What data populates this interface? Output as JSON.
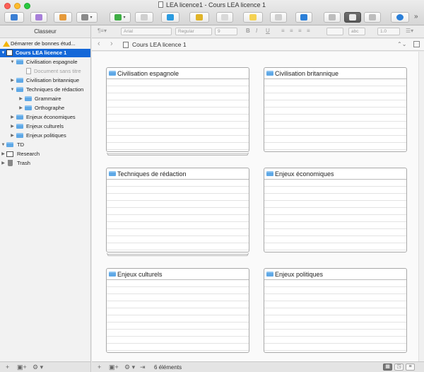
{
  "window": {
    "title": "LEA licence1 - Cours LEA licence 1"
  },
  "sidebar": {
    "header": "Classeur",
    "items": [
      {
        "label": "Démarrer de bonnes étud...",
        "icon": "warning-icon"
      },
      {
        "label": "Cours LEA licence 1",
        "icon": "book-icon",
        "selected": true
      },
      {
        "label": "Civilisation espagnole",
        "icon": "folder-icon"
      },
      {
        "label": "Document sans titre",
        "icon": "document-icon",
        "muted": true
      },
      {
        "label": "Civilisation britannique",
        "icon": "folder-icon"
      },
      {
        "label": "Techniques de rédaction",
        "icon": "folder-icon"
      },
      {
        "label": "Grammaire",
        "icon": "folder-icon"
      },
      {
        "label": "Orthographe",
        "icon": "folder-icon"
      },
      {
        "label": "Enjeux économiques",
        "icon": "folder-icon"
      },
      {
        "label": "Enjeux culturels",
        "icon": "folder-icon"
      },
      {
        "label": "Enjeux politiques",
        "icon": "folder-icon"
      },
      {
        "label": "TD",
        "icon": "folder-icon"
      },
      {
        "label": "Research",
        "icon": "research-icon"
      },
      {
        "label": "Trash",
        "icon": "trash-icon"
      }
    ],
    "footer": {
      "add": "+",
      "add_folder": "▣+",
      "settings": "⚙ ▾"
    }
  },
  "formatbar": {
    "font": "Arial",
    "style": "Regular",
    "size": "9",
    "bold": "B",
    "italic": "I",
    "underline": "U",
    "spacing": "1.0",
    "abc": "abc"
  },
  "header": {
    "title": "Cours LEA licence 1",
    "back": "‹",
    "forward": "›",
    "updown": "⌃⌄"
  },
  "cards": [
    {
      "title": "Civilisation espagnole",
      "stacked": true
    },
    {
      "title": "Civilisation britannique",
      "stacked": false
    },
    {
      "title": "Techniques de rédaction",
      "stacked": true
    },
    {
      "title": "Enjeux économiques",
      "stacked": false
    },
    {
      "title": "Enjeux culturels",
      "stacked": false
    },
    {
      "title": "Enjeux politiques",
      "stacked": false
    }
  ],
  "statusbar": {
    "count": "6 éléments"
  },
  "colors": {
    "selection": "#1568d8",
    "folder": "#5fa8e6",
    "warning": "#f3b400"
  }
}
